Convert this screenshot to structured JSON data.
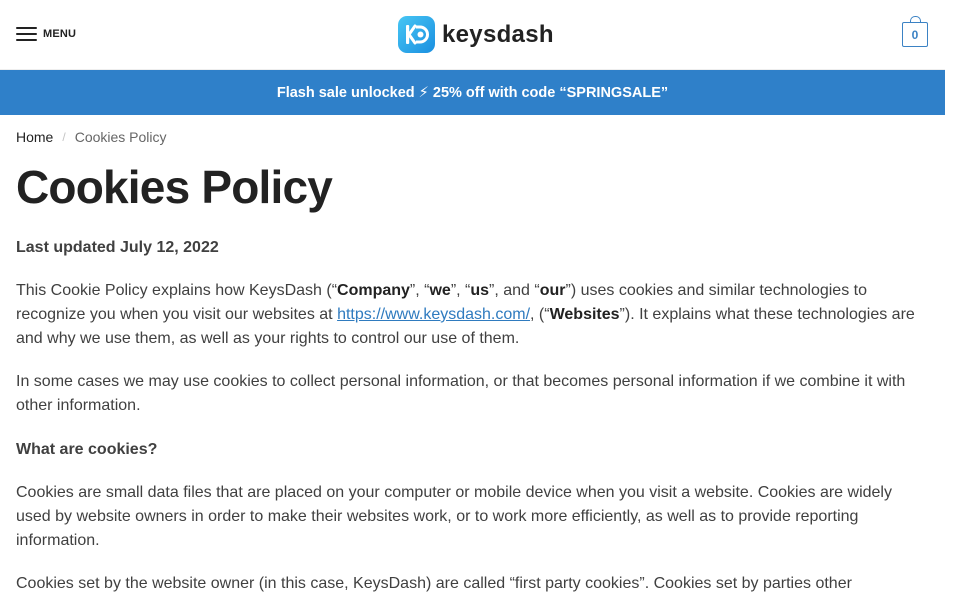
{
  "header": {
    "menu_label": "MENU",
    "logo_text": "keysdash",
    "cart_count": "0"
  },
  "banner": {
    "text": "Flash sale unlocked ⚡ 25% off with code “SPRINGSALE”"
  },
  "breadcrumb": {
    "home": "Home",
    "separator": "/",
    "current": "Cookies Policy"
  },
  "page": {
    "title": "Cookies Policy",
    "last_updated": "Last updated July 12, 2022",
    "intro": {
      "t1": "This Cookie Policy explains how KeysDash (“",
      "company": "Company",
      "t2": "”, “",
      "we": "we",
      "t3": "”, “",
      "us": "us",
      "t4": "”, and “",
      "our": "our",
      "t5": "”) uses cookies and similar technologies to recognize you when you visit our websites at ",
      "link": "https://www.keysdash.com/",
      "t6": ", (“",
      "websites": "Websites",
      "t7": "”). It explains what these technologies are and why we use them, as well as your rights to control our use of them."
    },
    "para2": "In some cases we may use cookies to collect personal information, or that becomes personal information if we combine it with other information.",
    "heading_what": "What are cookies?",
    "para3": "Cookies are small data files that are placed on your computer or mobile device when you visit a website. Cookies are widely used by website owners in order to make their websites work, or to work more efficiently, as well as to provide reporting information.",
    "para4": "Cookies set by the website owner (in this case, KeysDash) are called “first party cookies”. Cookies set by parties other"
  }
}
